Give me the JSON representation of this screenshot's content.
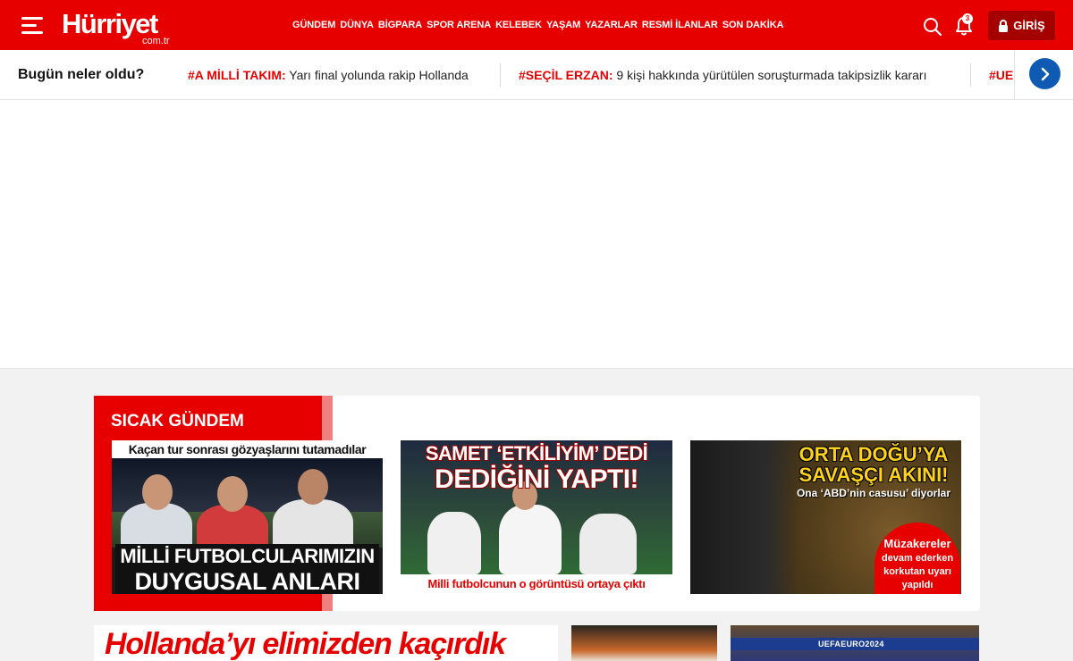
{
  "header": {
    "logo_text": "Hürriyet",
    "logo_sub": "com.tr",
    "nav": [
      "GÜNDEM",
      "DÜNYA",
      "BİGPARA",
      "SPOR ARENA",
      "KELEBEK",
      "YAŞAM",
      "YAZARLAR",
      "RESMİ İLANLAR",
      "SON DAKİKA"
    ],
    "notification_count": "3",
    "login_label": "GİRİŞ",
    "brand_color": "#e60000",
    "icons": {
      "menu": "hamburger-menu-icon",
      "search": "search-icon",
      "notifications": "bell-icon",
      "login": "lock-icon"
    }
  },
  "today": {
    "title": "Bugün neler oldu?",
    "items": [
      {
        "tag": "#A MİLLİ TAKIM:",
        "text": " Yarı final yolunda rakip Hollanda"
      },
      {
        "tag": "#SEÇİL ERZAN:",
        "text": " 9 kişi hakkında yürütülen soruşturmada takipsizlik kararı"
      },
      {
        "tag": "#UE",
        "text": ""
      }
    ],
    "next_icon": "chevron-right-icon"
  },
  "hot": {
    "title": "SICAK GÜNDEM",
    "cards": [
      {
        "top_line": "Kaçan tur sonrası gözyaşlarını tutamadılar",
        "caption_line1": "MİLLİ FUTBOLCULARIMIZIN",
        "caption_line2": "DUYGUSAL ANLARI"
      },
      {
        "headline_line1": "SAMET ‘ETKİLİYİM’ DEDİ",
        "headline_line2": "DEDİĞİNİ YAPTI!",
        "caption": "Milli futbolcunun o görüntüsü ortaya çıktı"
      },
      {
        "headline_line1": "ORTA DOĞU’YA",
        "headline_line2": "SAVAŞÇI AKINI!",
        "subline": "Ona ‘ABD’nin casusu’ diyorlar",
        "badge_line1": "Müzakereler",
        "badge_line2": "devam ederken korkutan uyarı yapıldı"
      }
    ]
  },
  "bottom": {
    "headline": "Hollanda’yı elimizden kaçırdık",
    "euro_label": "UEFAEURO2024"
  }
}
